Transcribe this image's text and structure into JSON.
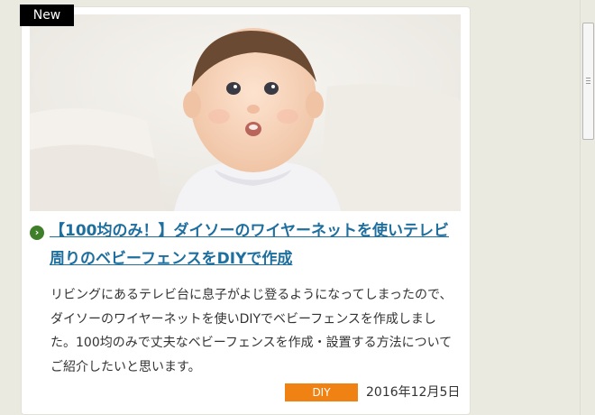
{
  "badge": {
    "label": "New"
  },
  "article": {
    "title": "【100均のみ！】ダイソーのワイヤーネットを使いテレビ周りのベビーフェンスをDIYで作成",
    "excerpt": "リビングにあるテレビ台に息子がよじ登るようになってしまったので、ダイソーのワイヤーネットを使いDIYでベビーフェンスを作成しました。100均のみで丈夫なベビーフェンスを作成・設置する方法についてご紹介したいと思います。",
    "category": "DIY",
    "date": "2016年12月5日"
  },
  "icons": {
    "title_bullet": "chevron-right-icon"
  },
  "colors": {
    "page_bg": "#ebeae0",
    "card_bg": "#ffffff",
    "link": "#1e6e9e",
    "bullet": "#3f7f2a",
    "category_bg": "#f08214",
    "badge_bg": "#000000"
  }
}
